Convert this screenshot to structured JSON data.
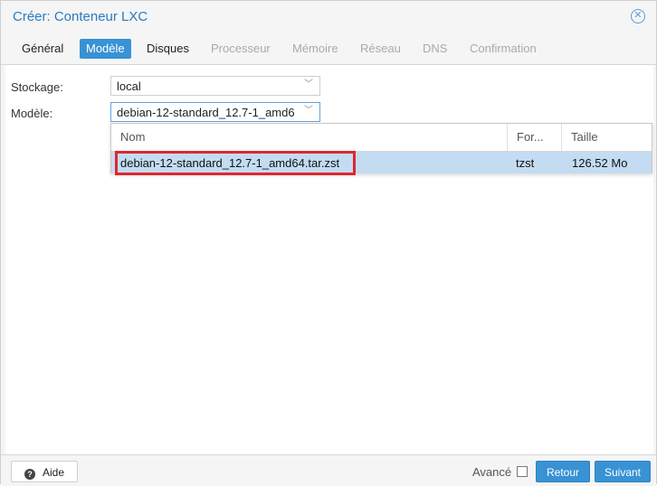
{
  "window": {
    "title": "Créer: Conteneur LXC",
    "close_icon": "close-icon"
  },
  "tabs": [
    {
      "label": "Général",
      "state": "normal"
    },
    {
      "label": "Modèle",
      "state": "active"
    },
    {
      "label": "Disques",
      "state": "normal"
    },
    {
      "label": "Processeur",
      "state": "disabled"
    },
    {
      "label": "Mémoire",
      "state": "disabled"
    },
    {
      "label": "Réseau",
      "state": "disabled"
    },
    {
      "label": "DNS",
      "state": "disabled"
    },
    {
      "label": "Confirmation",
      "state": "disabled"
    }
  ],
  "form": {
    "storage_label": "Stockage:",
    "storage_value": "local",
    "template_label": "Modèle:",
    "template_value": "debian-12-standard_12.7-1_amd6"
  },
  "dropdown": {
    "columns": [
      "Nom",
      "For...",
      "Taille"
    ],
    "rows": [
      {
        "name": "debian-12-standard_12.7-1_amd64.tar.zst",
        "format": "tzst",
        "size": "126.52 Mo",
        "selected": true
      }
    ]
  },
  "footer": {
    "help_label": "Aide",
    "advanced_label": "Avancé",
    "advanced_checked": false,
    "back_label": "Retour",
    "next_label": "Suivant"
  },
  "colors": {
    "accent": "#3892d4",
    "title": "#2a7bbf",
    "selection": "#c3dcf2",
    "highlight": "#e0262e"
  }
}
